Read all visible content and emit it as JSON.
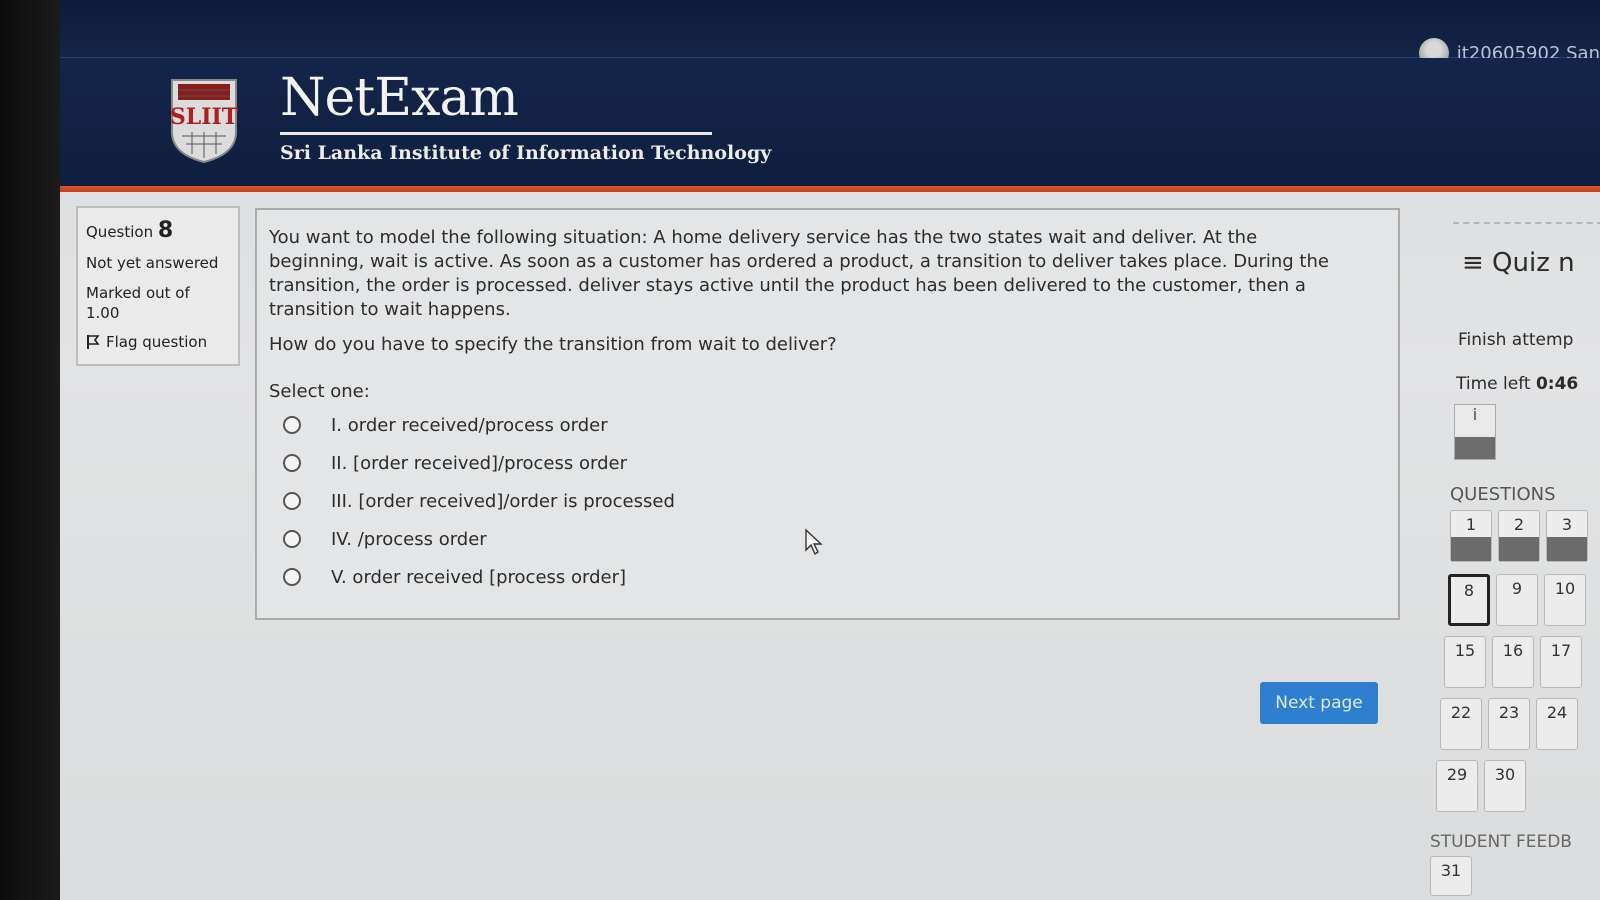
{
  "header": {
    "user_name": "it20605902 San",
    "brand_title": "NetExam",
    "brand_subtitle": "Sri Lanka Institute of Information Technology",
    "logo_text": "SLIIT"
  },
  "question_info": {
    "label": "Question",
    "number": "8",
    "status": "Not yet answered",
    "marked_out_of": "Marked out of",
    "mark_value": "1.00",
    "flag_label": "Flag question"
  },
  "question": {
    "text": "You want to model the following situation: A home delivery service has the two states wait and deliver. At the beginning, wait is active. As soon as a customer has ordered a product, a transition to deliver takes place. During the transition, the order is processed. deliver stays active until the product has been delivered to the customer, then a transition to wait happens.",
    "prompt": "How do you have to specify the transition from wait to deliver?",
    "select_one": "Select one:",
    "options": [
      "I. order received/process order",
      "II. [order received]/process order",
      "III.  [order received]/order is processed",
      "IV. /process order",
      "V. order received [process order]"
    ]
  },
  "next_button": "Next page",
  "quiz_nav": {
    "title": "≡ Quiz n",
    "finish": "Finish attemp",
    "time_left_label": "Time left",
    "time_left_value": "0:46",
    "info_badge": "i",
    "questions_label": "QUESTIONS",
    "question_numbers": [
      "1",
      "2",
      "3",
      "8",
      "9",
      "10",
      "15",
      "16",
      "17",
      "22",
      "23",
      "24",
      "29",
      "30"
    ],
    "feedback_label": "STUDENT FEEDB",
    "feedback_number": "31"
  }
}
